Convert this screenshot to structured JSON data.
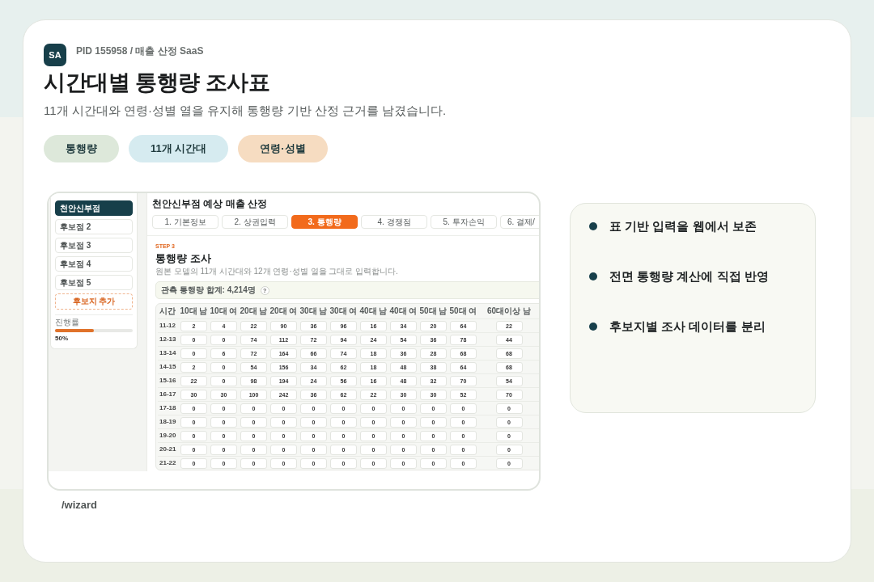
{
  "header": {
    "logo": "SA",
    "meta": "PID 155958 / 매출 산정 SaaS",
    "title": "시간대별 통행량 조사표",
    "subtitle": "11개 시간대와 연령·성별 열을 유지해 통행량 기반 산정 근거를 남겼습니다."
  },
  "tags": [
    {
      "label": "통행량",
      "color": "#dde8da"
    },
    {
      "label": "11개 시간대",
      "color": "#d6ebf0"
    },
    {
      "label": "연령·성별",
      "color": "#f6dcc1"
    }
  ],
  "screenshot": {
    "sidebar": {
      "items": [
        {
          "label": "천안신부점",
          "selected": true
        },
        {
          "label": "후보점 2",
          "selected": false
        },
        {
          "label": "후보점 3",
          "selected": false
        },
        {
          "label": "후보점 4",
          "selected": false
        },
        {
          "label": "후보점 5",
          "selected": false
        }
      ],
      "add_button": "후보지 추가",
      "progress": {
        "label": "진행률",
        "level": 0.5,
        "reading": "50%"
      }
    },
    "title": "천안신부점 예상 매출 산정",
    "steps": [
      {
        "label": "1. 기본정보",
        "selected": false
      },
      {
        "label": "2. 상권입력",
        "selected": false
      },
      {
        "label": "3. 통행량",
        "selected": true
      },
      {
        "label": "4. 경쟁점",
        "selected": false
      },
      {
        "label": "5. 투자손익",
        "selected": false
      },
      {
        "label": "6. 결제/",
        "selected": false
      }
    ],
    "step_label": "STEP 3",
    "section_title": "통행량 조사",
    "description": "원본 모델의 11개 시간대와 12개 연령·성별 열을 그대로 입력합니다.",
    "summary": "관측 통행량 합계: 4,214명",
    "help": "?",
    "table": {
      "columns": [
        "시간",
        "10대 남",
        "10대 여",
        "20대 남",
        "20대 여",
        "30대 남",
        "30대 여",
        "40대 남",
        "40대 여",
        "50대 남",
        "50대 여",
        "60대이상 남"
      ],
      "rows": [
        {
          "time": "11-12",
          "values": [
            "2",
            "4",
            "22",
            "90",
            "36",
            "96",
            "16",
            "34",
            "20",
            "64",
            "22"
          ]
        },
        {
          "time": "12-13",
          "values": [
            "0",
            "0",
            "74",
            "112",
            "72",
            "94",
            "24",
            "54",
            "36",
            "78",
            "44"
          ]
        },
        {
          "time": "13-14",
          "values": [
            "0",
            "6",
            "72",
            "164",
            "66",
            "74",
            "18",
            "36",
            "28",
            "68",
            "68"
          ]
        },
        {
          "time": "14-15",
          "values": [
            "2",
            "0",
            "54",
            "156",
            "34",
            "62",
            "18",
            "48",
            "38",
            "64",
            "68"
          ]
        },
        {
          "time": "15-16",
          "values": [
            "22",
            "0",
            "98",
            "194",
            "24",
            "56",
            "16",
            "48",
            "32",
            "70",
            "54"
          ]
        },
        {
          "time": "16-17",
          "values": [
            "30",
            "30",
            "100",
            "242",
            "36",
            "62",
            "22",
            "30",
            "30",
            "52",
            "70"
          ]
        },
        {
          "time": "17-18",
          "values": [
            "0",
            "0",
            "0",
            "0",
            "0",
            "0",
            "0",
            "0",
            "0",
            "0",
            "0"
          ]
        },
        {
          "time": "18-19",
          "values": [
            "0",
            "0",
            "0",
            "0",
            "0",
            "0",
            "0",
            "0",
            "0",
            "0",
            "0"
          ]
        },
        {
          "time": "19-20",
          "values": [
            "0",
            "0",
            "0",
            "0",
            "0",
            "0",
            "0",
            "0",
            "0",
            "0",
            "0"
          ]
        },
        {
          "time": "20-21",
          "values": [
            "0",
            "0",
            "0",
            "0",
            "0",
            "0",
            "0",
            "0",
            "0",
            "0",
            "0"
          ]
        },
        {
          "time": "21-22",
          "values": [
            "0",
            "0",
            "0",
            "0",
            "0",
            "0",
            "0",
            "0",
            "0",
            "0",
            "0"
          ]
        }
      ]
    }
  },
  "caption": "/wizard",
  "highlights": [
    "표 기반 입력을 웹에서 보존",
    "전면 통행량 계산에 직접 반영",
    "후보지별 조사 데이터를 분리"
  ]
}
